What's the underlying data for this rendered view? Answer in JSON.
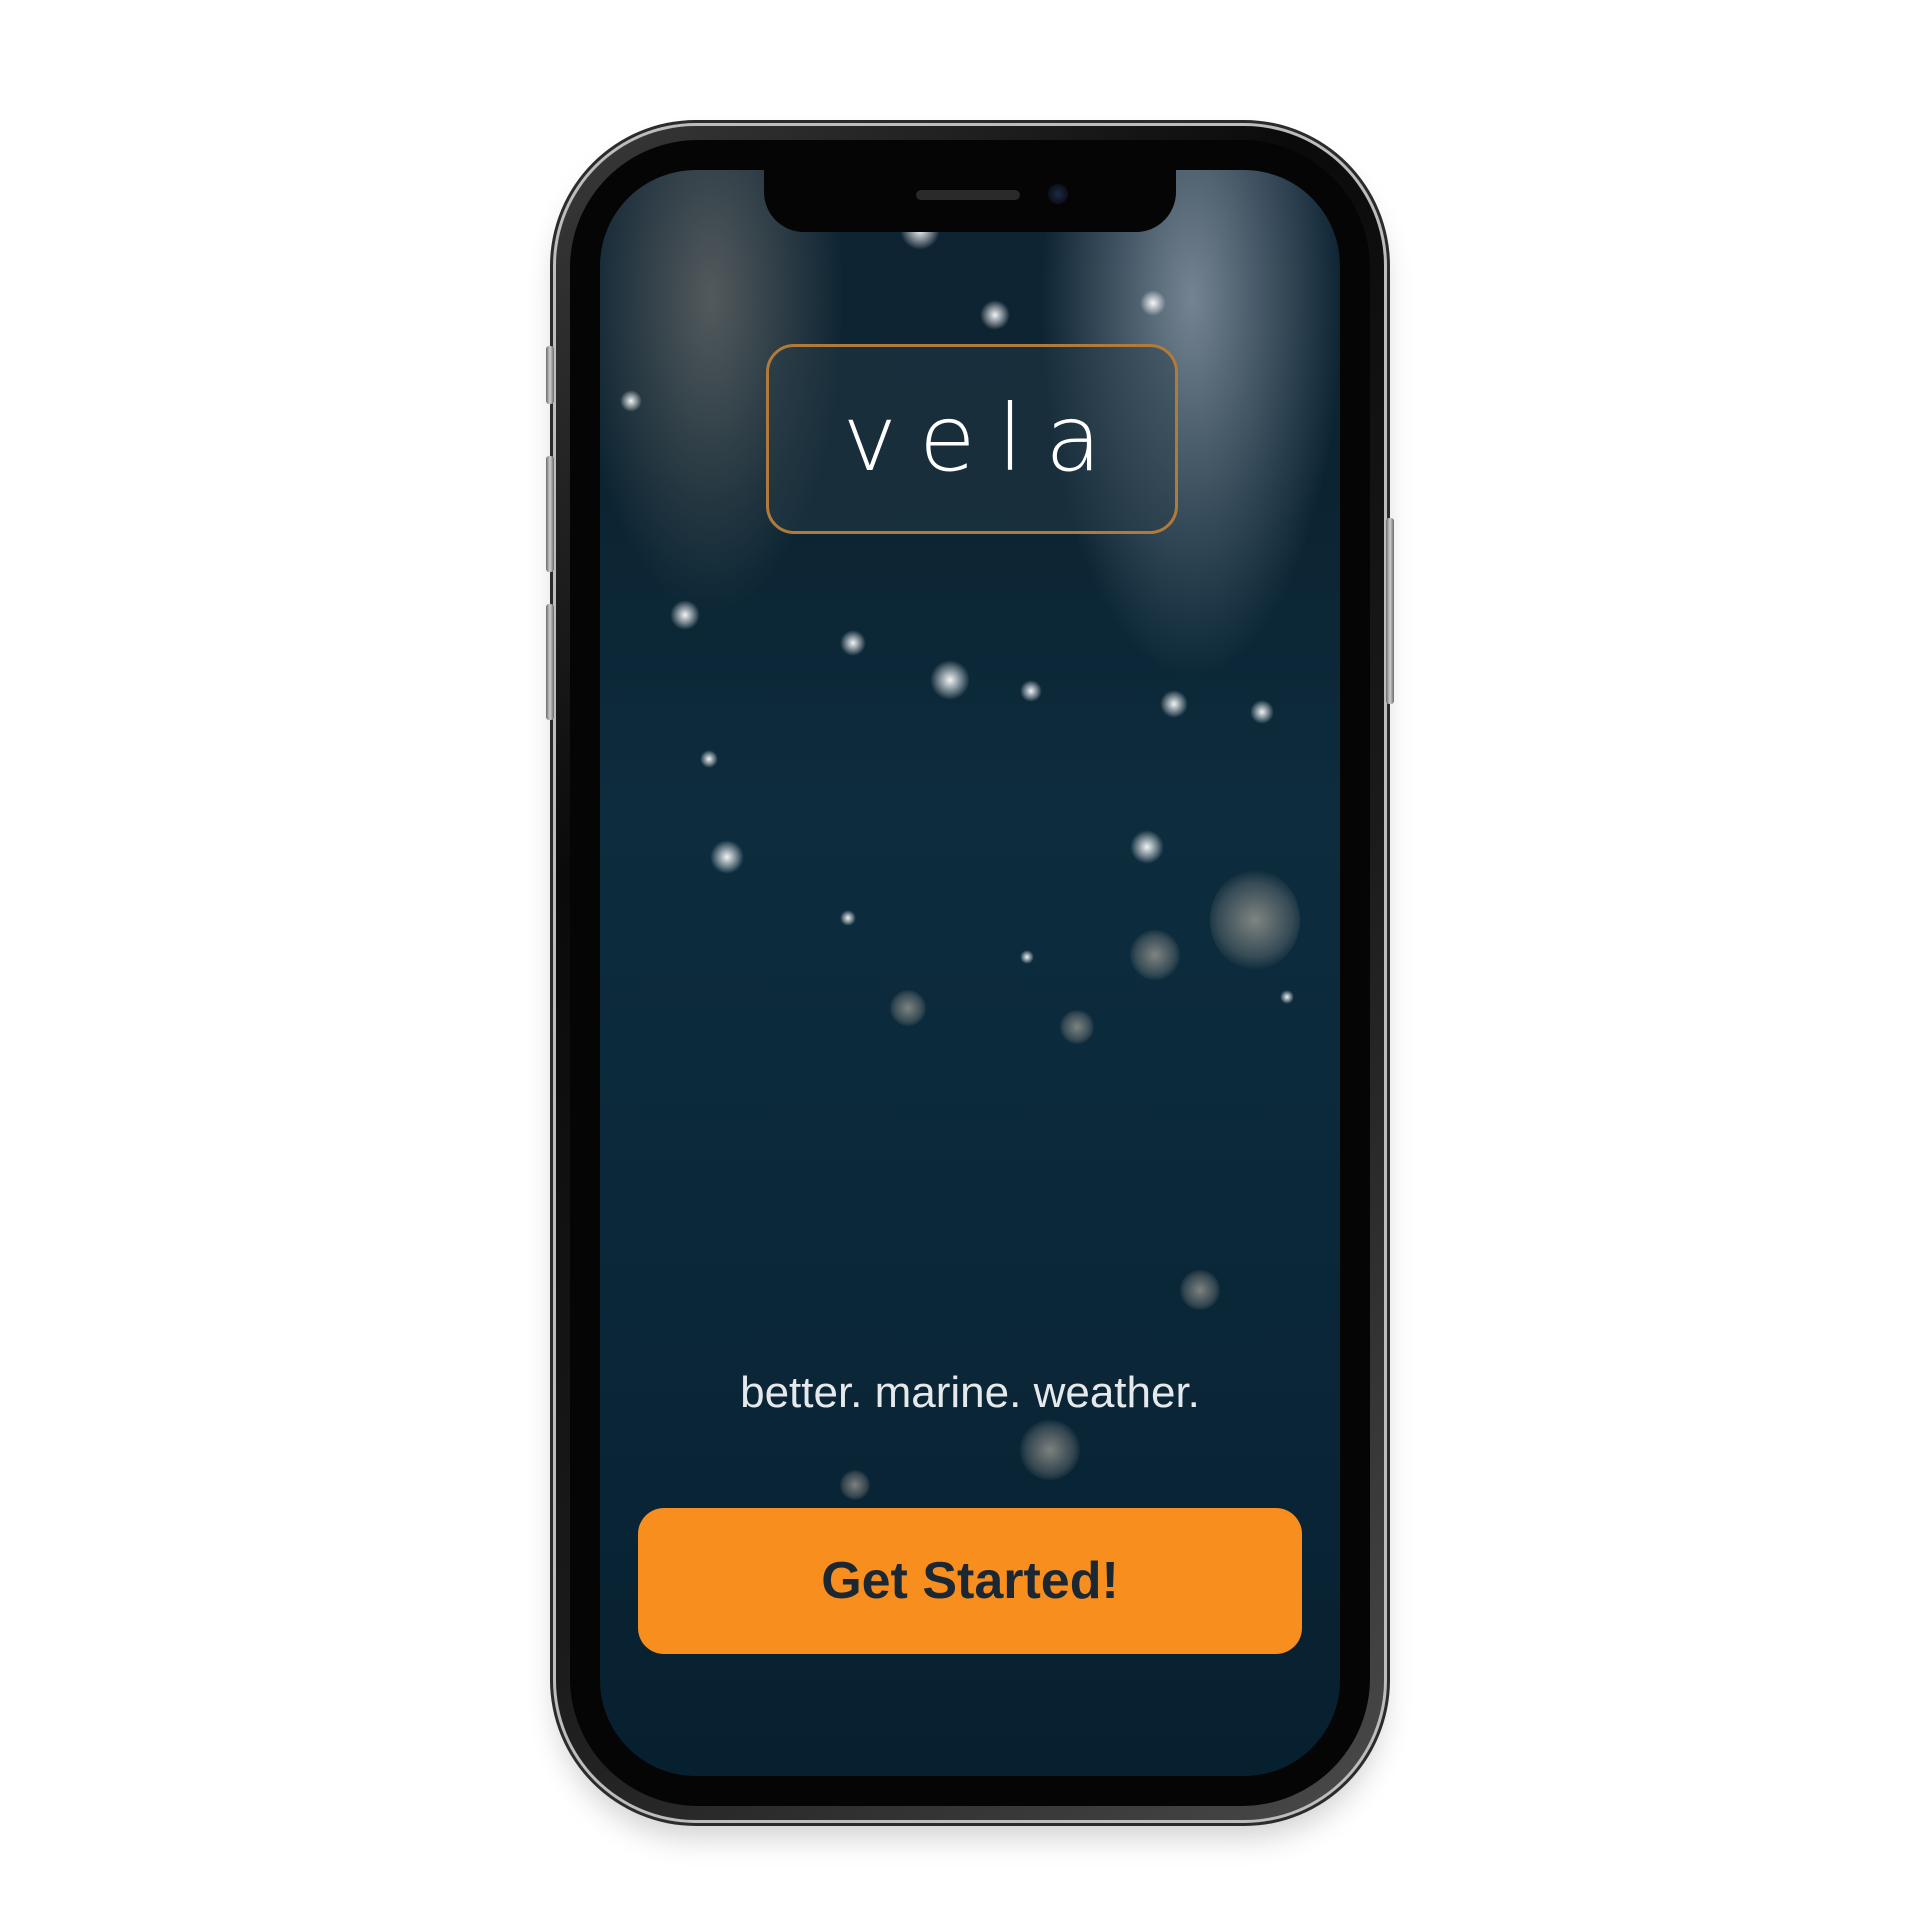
{
  "app": {
    "name": "vela",
    "tagline": "better. marine. weather."
  },
  "actions": {
    "get_started_label": "Get Started!"
  },
  "colors": {
    "accent": "#f88e1e",
    "logo_border": "#b07a3a",
    "background_deep": "#0a2637",
    "button_text": "#1b2733"
  }
}
